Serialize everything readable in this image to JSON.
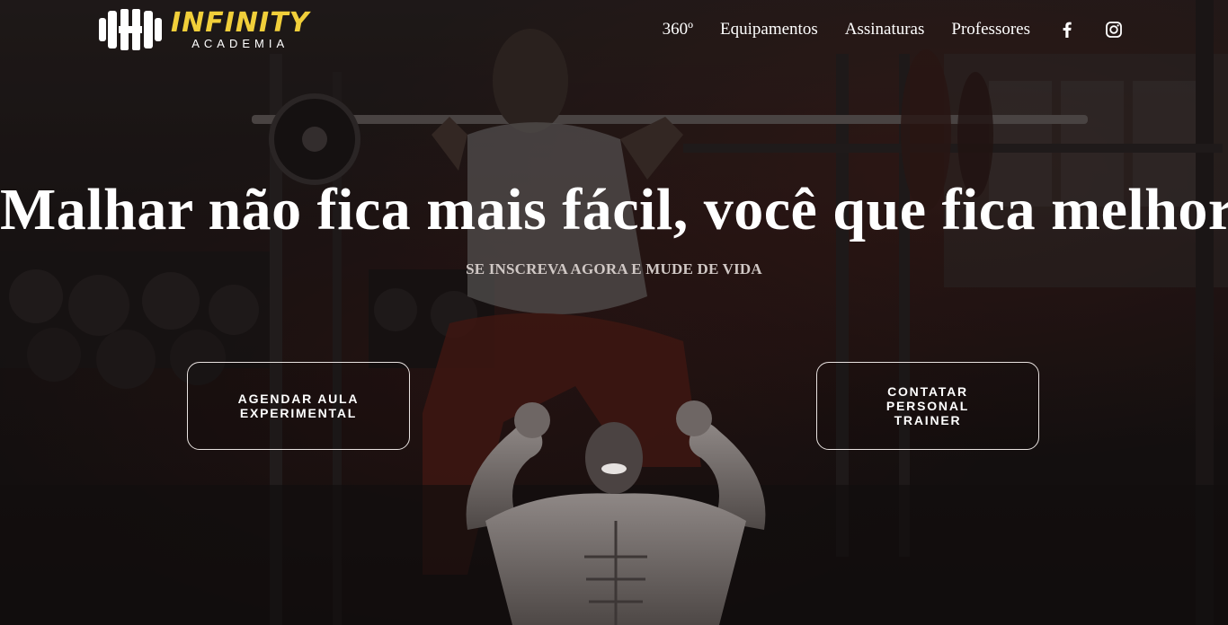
{
  "logo": {
    "title": "INFINITY",
    "subtitle": "ACADEMIA",
    "icon": "dumbbell-h-icon",
    "accent_color": "#f1cf3a"
  },
  "nav": {
    "items": [
      {
        "label": "360º"
      },
      {
        "label": "Equipamentos"
      },
      {
        "label": "Assinaturas"
      },
      {
        "label": "Professores"
      }
    ],
    "social": [
      {
        "icon": "facebook-icon"
      },
      {
        "icon": "instagram-icon"
      }
    ]
  },
  "hero": {
    "headline": "Malhar não fica mais fácil, você que fica melhor!",
    "subheadline": "SE INSCREVA AGORA E MUDE DE VIDA",
    "buttons": [
      {
        "label": "AGENDAR AULA EXPERIMENTAL"
      },
      {
        "label": "CONTATAR PERSONAL TRAINER"
      }
    ]
  }
}
